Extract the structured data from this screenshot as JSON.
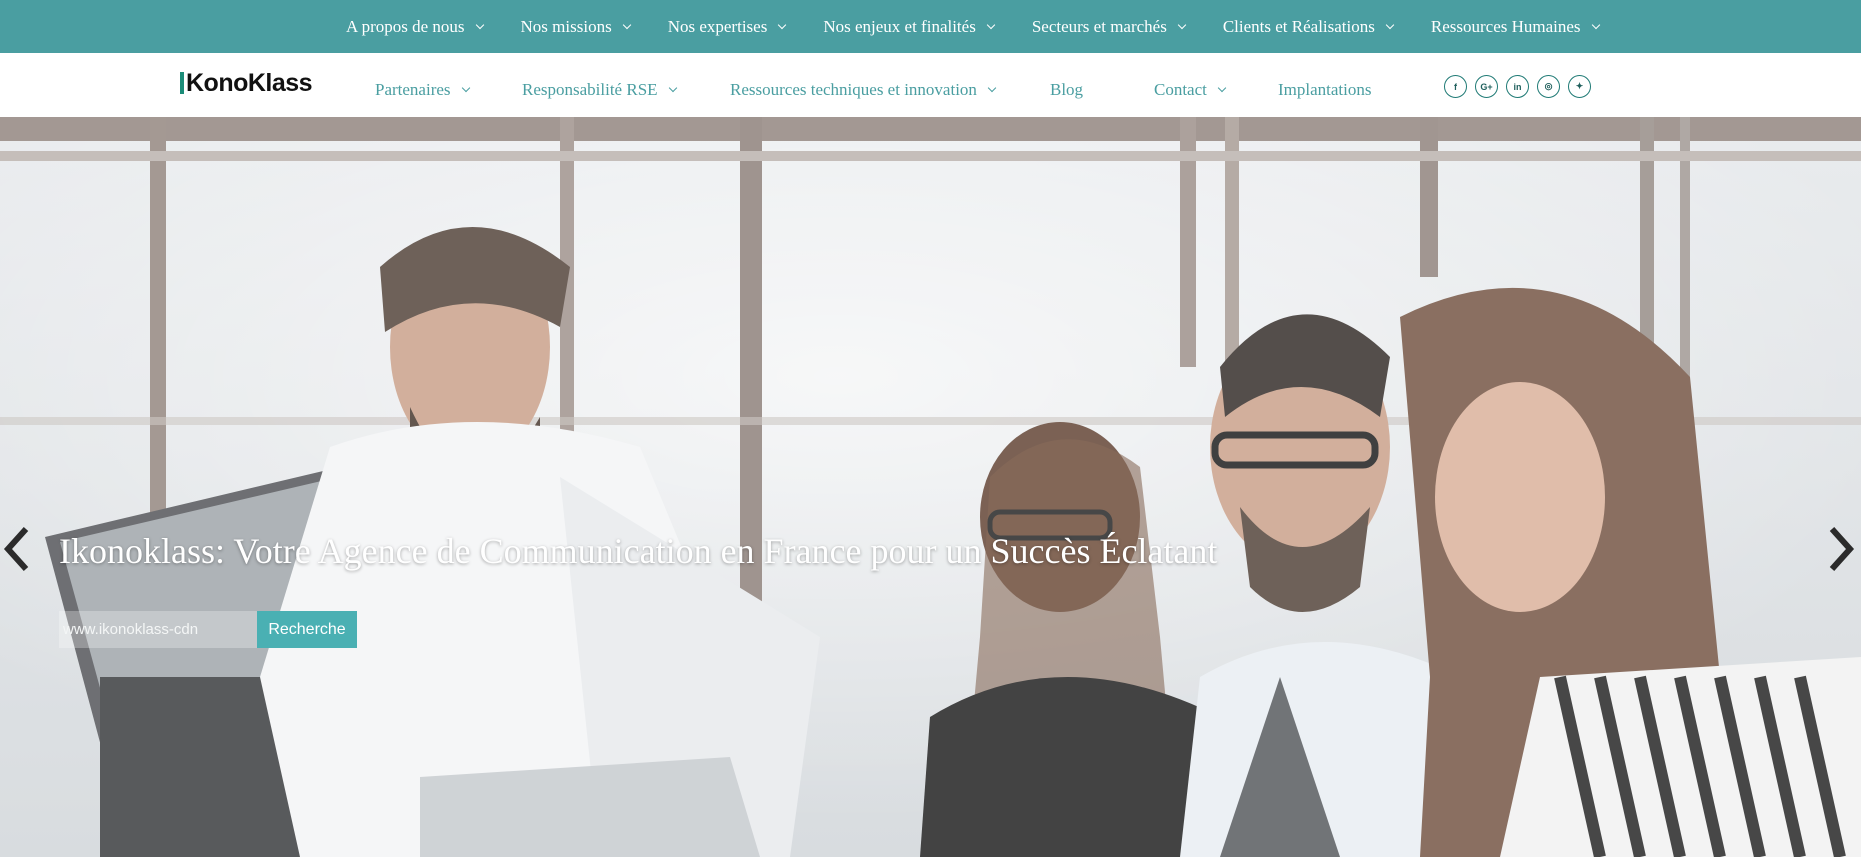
{
  "top_nav": [
    {
      "label": "A propos de nous"
    },
    {
      "label": "Nos missions"
    },
    {
      "label": "Nos expertises"
    },
    {
      "label": "Nos enjeux et finalités"
    },
    {
      "label": "Secteurs et marchés"
    },
    {
      "label": "Clients et Réalisations"
    },
    {
      "label": "Ressources Humaines"
    }
  ],
  "logo": {
    "text_a": "Kono",
    "text_b": "Klass"
  },
  "secondary_nav": [
    {
      "label": "Partenaires"
    },
    {
      "label": "Responsabilité RSE"
    },
    {
      "label": "Ressources techniques et innovation"
    },
    {
      "label": "Blog"
    },
    {
      "label": "Contact"
    },
    {
      "label": "Implantations"
    }
  ],
  "social": [
    {
      "icon": "facebook-icon",
      "glyph": "f"
    },
    {
      "icon": "google-plus-icon",
      "glyph": "G+"
    },
    {
      "icon": "linkedin-icon",
      "glyph": "in"
    },
    {
      "icon": "instagram-icon",
      "glyph": "◎"
    },
    {
      "icon": "twitter-icon",
      "glyph": "✦"
    }
  ],
  "hero": {
    "headline": "Ikonoklass: Votre Agence de Communication en France pour un Succès Éclatant",
    "search_value": "www.ikonoklass-cdn",
    "search_button": "Recherche",
    "prev_icon": "chevron-left-icon",
    "next_icon": "chevron-right-icon"
  },
  "colors": {
    "brand": "#4a9ea1",
    "button": "#4ab0b3",
    "logo_accent": "#1b8c78"
  }
}
